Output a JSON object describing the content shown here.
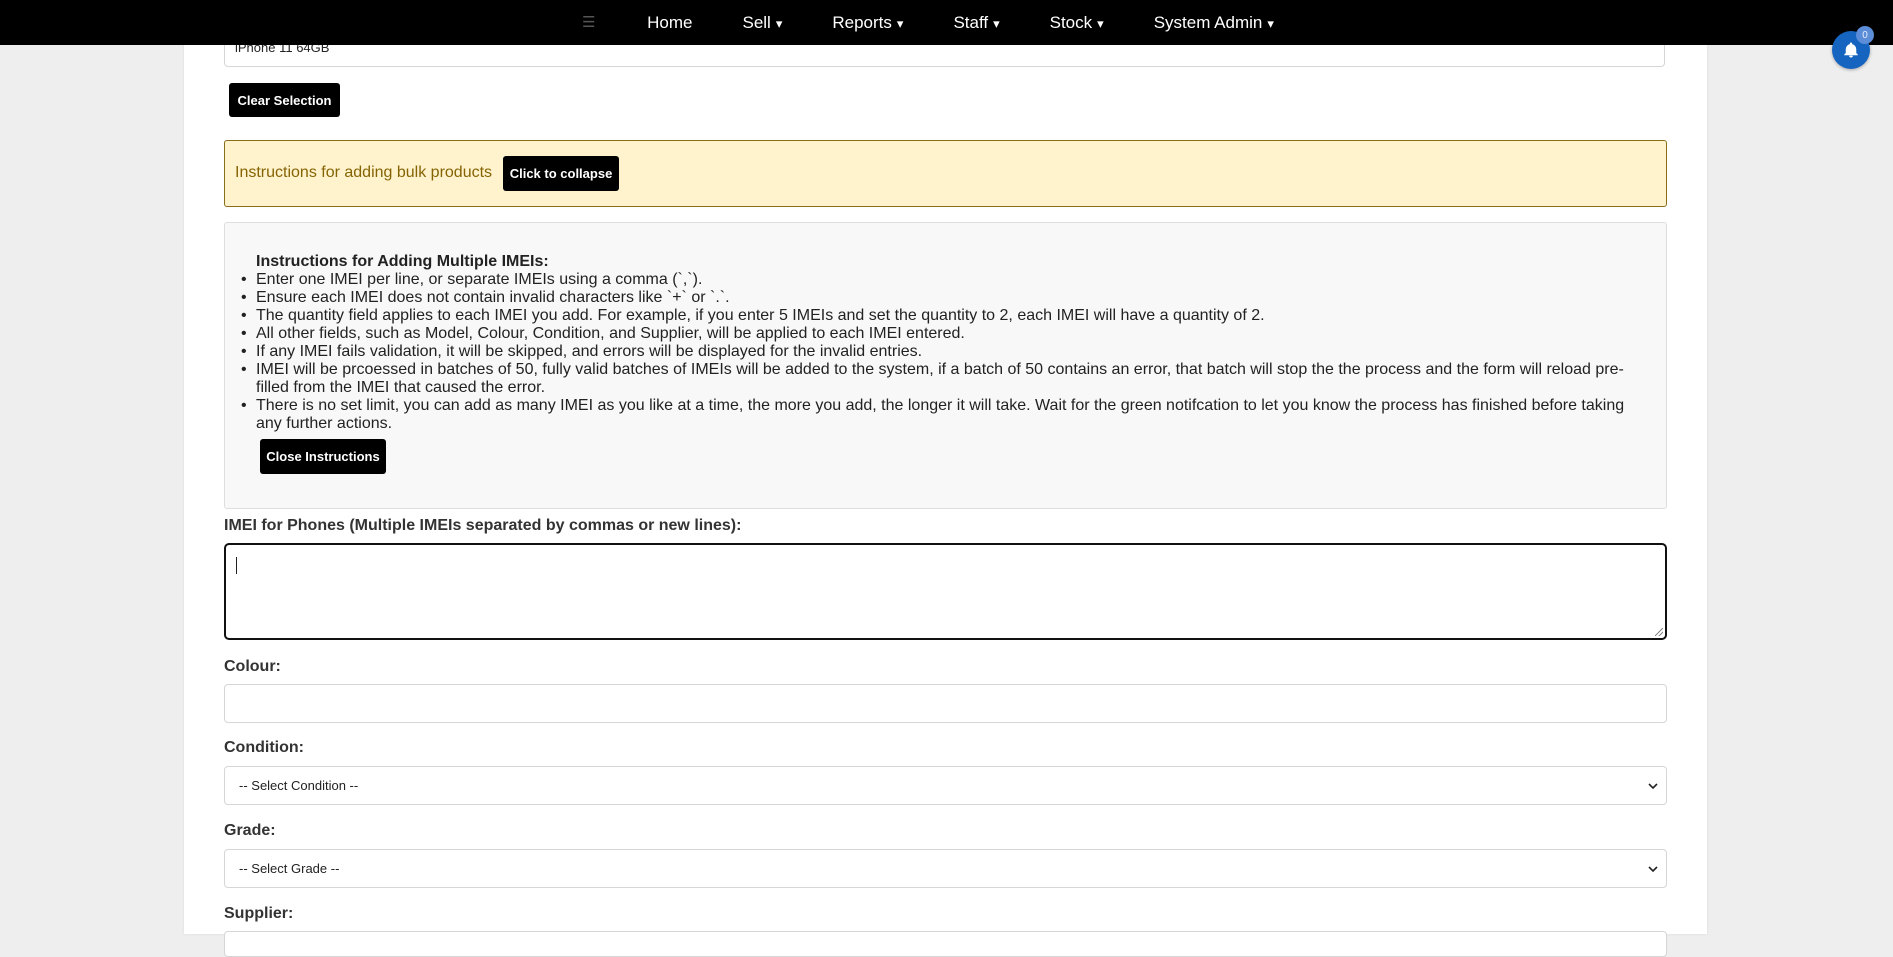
{
  "nav": {
    "items": [
      {
        "label": "Home",
        "caret": ""
      },
      {
        "label": "Sell",
        "caret": "▾"
      },
      {
        "label": "Reports",
        "caret": "▾"
      },
      {
        "label": "Staff",
        "caret": "▾"
      },
      {
        "label": "Stock",
        "caret": "▾"
      },
      {
        "label": "System Admin",
        "caret": "▾"
      }
    ]
  },
  "notifications": {
    "count": "0"
  },
  "form": {
    "selected_model": "iPhone 11 64GB",
    "clear_selection_label": "Clear Selection",
    "instructions_banner": "Instructions for adding bulk products",
    "collapse_label": "Click to collapse",
    "instructions_title": "Instructions for Adding Multiple IMEIs:",
    "instructions": [
      "Enter one IMEI per line, or separate IMEIs using a comma (`,`).",
      "Ensure each IMEI does not contain invalid characters like `+` or `.`.",
      "The quantity field applies to each IMEI you add. For example, if you enter 5 IMEIs and set the quantity to 2, each IMEI will have a quantity of 2.",
      "All other fields, such as Model, Colour, Condition, and Supplier, will be applied to each IMEI entered.",
      "If any IMEI fails validation, it will be skipped, and errors will be displayed for the invalid entries.",
      "IMEI will be prcoessed in batches of 50, fully valid batches of IMEIs will be added to the system, if a batch of 50 contains an error, that batch will stop the the process and the form will reload pre-filled from the IMEI that caused the error.",
      "There is no set limit, you can add as many IMEI as you like at a time, the more you add, the longer it will take. Wait for the green notifcation to let you know the process has finished before taking any further actions."
    ],
    "close_instructions_label": "Close Instructions",
    "imei_label": "IMEI for Phones (Multiple IMEIs separated by commas or new lines):",
    "imei_value": "",
    "colour_label": "Colour:",
    "colour_value": "",
    "condition_label": "Condition:",
    "condition_selected": "-- Select Condition --",
    "grade_label": "Grade:",
    "grade_selected": "-- Select Grade --",
    "supplier_label": "Supplier:"
  }
}
